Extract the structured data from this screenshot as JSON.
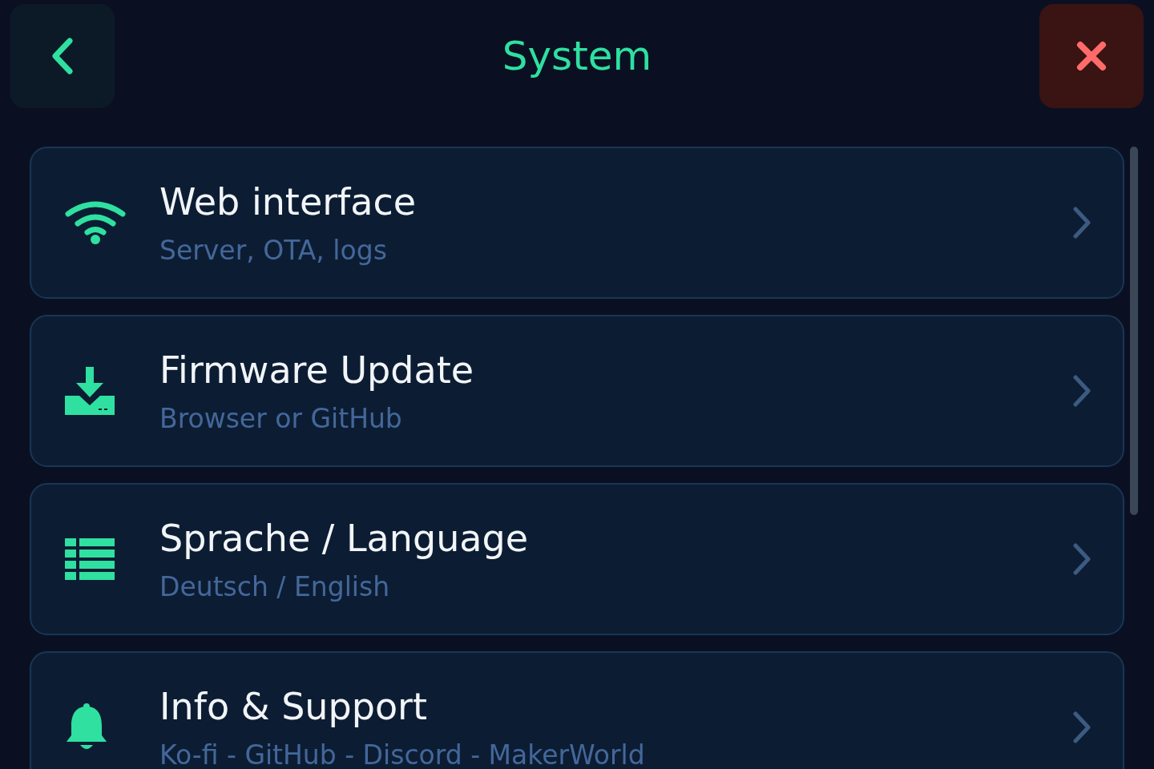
{
  "header": {
    "title": "System"
  },
  "items": [
    {
      "title": "Web interface",
      "subtitle": "Server, OTA, logs"
    },
    {
      "title": "Firmware Update",
      "subtitle": "Browser or GitHub"
    },
    {
      "title": "Sprache / Language",
      "subtitle": "Deutsch / English"
    },
    {
      "title": "Info & Support",
      "subtitle": "Ko-fi - GitHub - Discord - MakerWorld"
    }
  ]
}
